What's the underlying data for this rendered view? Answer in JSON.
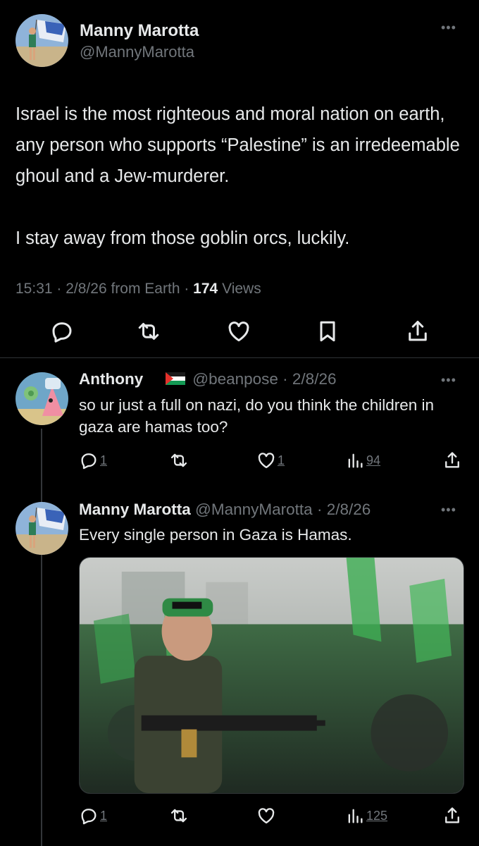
{
  "main_tweet": {
    "author_name": "Manny Marotta",
    "author_handle": "@MannyMarotta",
    "text": "Israel is the most righteous and moral nation on earth, any person who supports “Palestine” is an irredeemable ghoul and a Jew-murderer.\n\nI stay away from those goblin orcs, luckily.",
    "time": "15:31",
    "date": "2/8/26",
    "source": "from Earth",
    "views_count": "174",
    "views_label": "Views",
    "actions": [
      "reply-icon",
      "retweet-icon",
      "like-icon",
      "bookmark-icon",
      "share-icon"
    ]
  },
  "replies": [
    {
      "author_name": "Anthony",
      "flag": "palestine-flag-emoji",
      "author_handle": "@beanpose",
      "date": "2/8/26",
      "text": "so ur just a full on nazi, do you think the children in gaza are hamas too?",
      "reply_count": "1",
      "retweet_count": "",
      "like_count": "1",
      "views": "94"
    },
    {
      "author_name": "Manny Marotta",
      "author_handle": "@MannyMarotta",
      "date": "2/8/26",
      "text": "Every single person in Gaza is Hamas.",
      "has_media": true,
      "reply_count": "1",
      "retweet_count": "",
      "like_count": "",
      "views": "125"
    }
  ],
  "colors": {
    "background": "#000000",
    "text_primary": "#e7e9ea",
    "text_secondary": "#71767b",
    "divider": "#2f3336"
  }
}
